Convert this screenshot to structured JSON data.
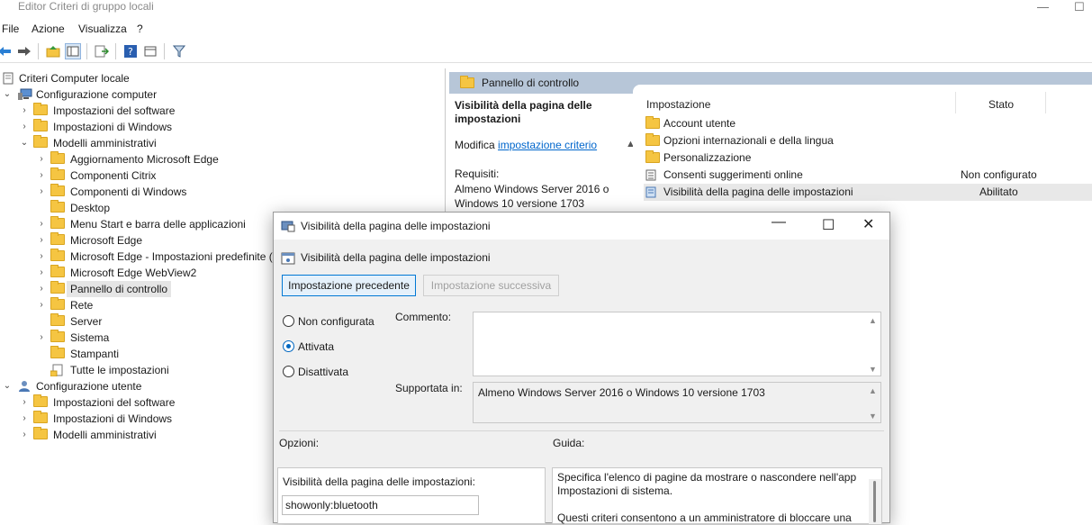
{
  "window": {
    "title": "Editor Criteri di gruppo locali",
    "minimize": "—",
    "maximize": "☐"
  },
  "menu": [
    "File",
    "Azione",
    "Visualizza",
    "?"
  ],
  "tree": {
    "root": "Criteri Computer locale",
    "computer_config": "Configurazione computer",
    "sw_settings": "Impostazioni del software",
    "win_settings": "Impostazioni di Windows",
    "admin_templates": "Modelli amministrativi",
    "children": [
      "Aggiornamento Microsoft Edge",
      "Componenti Citrix",
      "Componenti di Windows",
      "Desktop",
      "Menu Start e barra delle applicazioni",
      "Microsoft Edge",
      "Microsoft Edge - Impostazioni predefinite (",
      "Microsoft Edge WebView2",
      "Pannello di controllo",
      "Rete",
      "Server",
      "Sistema",
      "Stampanti",
      "Tutte le impostazioni"
    ],
    "user_config": "Configurazione utente",
    "user_sw": "Impostazioni del software",
    "user_win": "Impostazioni di Windows",
    "user_admin": "Modelli amministrativi"
  },
  "rightpane": {
    "header": "Pannello di controllo",
    "desc_title": "Visibilità della pagina delle impostazioni",
    "modify_prefix": "Modifica",
    "modify_link": "impostazione criterio",
    "req_label": "Requisiti:",
    "req_value": "Almeno Windows Server 2016 o Windows 10 versione 1703",
    "col_setting": "Impostazione",
    "col_state": "Stato",
    "rows": [
      {
        "name": "Account utente",
        "state": ""
      },
      {
        "name": "Opzioni internazionali e della lingua",
        "state": ""
      },
      {
        "name": "Personalizzazione",
        "state": ""
      },
      {
        "name": "Consenti suggerimenti online",
        "state": "Non configurato"
      },
      {
        "name": "Visibilità della pagina delle impostazioni",
        "state": "Abilitato"
      }
    ]
  },
  "dialog": {
    "title": "Visibilità della pagina delle impostazioni",
    "subtitle": "Visibilità della pagina delle impostazioni",
    "prev_btn": "Impostazione precedente",
    "next_btn": "Impostazione successiva",
    "radio_not_configured": "Non configurata",
    "radio_enabled": "Attivata",
    "radio_disabled": "Disattivata",
    "comment_label": "Commento:",
    "supported_label": "Supportata in:",
    "supported_value": "Almeno Windows Server 2016 o Windows 10 versione 1703",
    "options_label": "Opzioni:",
    "help_label": "Guida:",
    "option_field_label": "Visibilità della pagina delle impostazioni:",
    "option_field_value": "showonly:bluetooth",
    "help_text_1": "Specifica l'elenco di pagine da mostrare o nascondere nell'app Impostazioni di sistema.",
    "help_text_2": "Questi criteri consentono a un amministratore di bloccare una"
  }
}
